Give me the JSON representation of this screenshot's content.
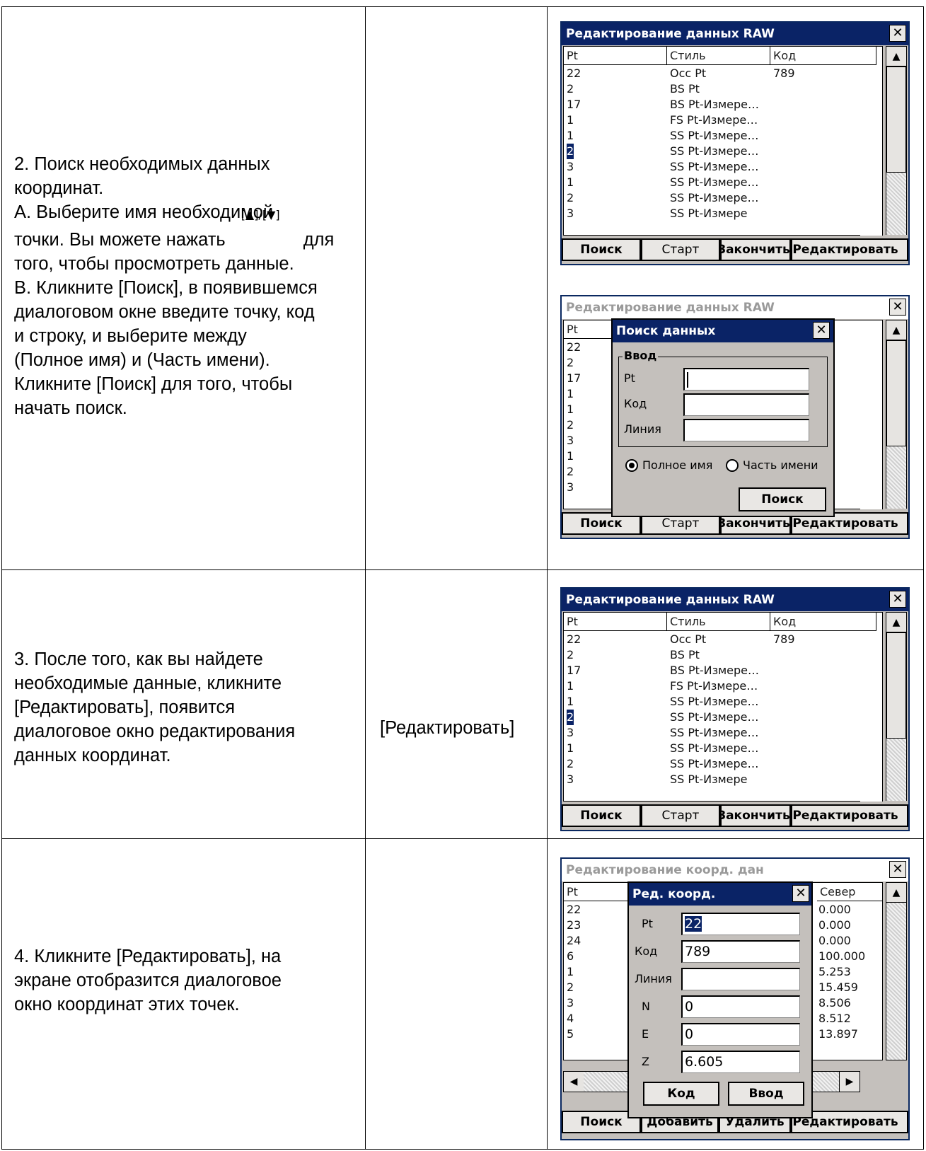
{
  "rows": [
    {
      "step_lines": [
        "2. Поиск необходимых данных",
        "координат.",
        "A. Выберите имя необходимой",
        "__ARROWS__",
        "того, чтобы просмотреть данные.",
        "B. Кликните [Поиск], в появившемся",
        "диалоговом окне введите точку, код",
        "и строку, и выберите между",
        "(Полное имя) и (Часть имени).",
        "Кликните [Поиск] для того, чтобы",
        "начать поиск."
      ],
      "arrows_line": {
        "before": "точки. Вы можете нажать",
        "keys": "[▲]/[▼]",
        "after": "для"
      },
      "key": ""
    },
    {
      "step_lines": [
        "3. После того, как вы найдете",
        "необходимые данные, кликните",
        "[Редактировать], появится",
        "диалоговое окно редактирования",
        "данных координат."
      ],
      "key": "[Редактировать]"
    },
    {
      "step_lines": [
        "4. Кликните [Редактировать], на",
        "экране отобразится диалоговое",
        "окно координат этих точек."
      ],
      "key": ""
    }
  ],
  "raw_window": {
    "title": "Редактирование данных RAW",
    "columns": [
      "Pt",
      "Стиль",
      "Код"
    ],
    "rows": [
      [
        "22",
        "Occ Pt",
        "789"
      ],
      [
        "2",
        "BS Pt",
        ""
      ],
      [
        "17",
        "BS Pt-Измере…",
        ""
      ],
      [
        "1",
        "FS Pt-Измере…",
        ""
      ],
      [
        "1",
        "SS Pt-Измере…",
        ""
      ],
      [
        "2",
        "SS Pt-Измере…",
        ""
      ],
      [
        "3",
        "SS Pt-Измере…",
        ""
      ],
      [
        "1",
        "SS Pt-Измере…",
        ""
      ],
      [
        "2",
        "SS Pt-Измере…",
        ""
      ],
      [
        "3",
        "SS Pt-Измере",
        ""
      ]
    ],
    "selected_row": 5,
    "buttons": [
      "Поиск",
      "Старт",
      "Закончить",
      "Редактировать"
    ]
  },
  "search_dialog": {
    "title": "Поиск данных",
    "group": "Ввод",
    "fields": [
      {
        "label": "Pt",
        "value": ""
      },
      {
        "label": "Код",
        "value": ""
      },
      {
        "label": "Линия",
        "value": ""
      }
    ],
    "radio_full": "Полное имя",
    "radio_part": "Часть имени",
    "radio_selected": "full",
    "search_button": "Поиск"
  },
  "coord_window": {
    "title": "Редактирование коорд. дан",
    "col_pt": "Pt",
    "col_north": "Север",
    "pts": [
      "22",
      "23",
      "24",
      "6",
      "1",
      "2",
      "3",
      "4",
      "5"
    ],
    "north": [
      "0.000",
      "0.000",
      "0.000",
      "100.000",
      "5.253",
      "15.459",
      "8.506",
      "8.512",
      "13.897"
    ],
    "buttons": [
      "Поиск",
      "Добавить",
      "Удалить",
      "Редактировать"
    ]
  },
  "edit_dialog": {
    "title": "Ред. коорд.",
    "fields": [
      {
        "label": "Pt",
        "value": "22"
      },
      {
        "label": "Код",
        "value": "789"
      },
      {
        "label": "Линия",
        "value": ""
      },
      {
        "label": "N",
        "value": "0"
      },
      {
        "label": "E",
        "value": "0"
      },
      {
        "label": "Z",
        "value": "6.605"
      }
    ],
    "btn_code": "Код",
    "btn_enter": "Ввод"
  },
  "icons": {
    "close": "close-icon",
    "up": "up-arrow-icon",
    "down": "down-arrow-icon",
    "left": "left-arrow-icon",
    "right": "right-arrow-icon"
  }
}
